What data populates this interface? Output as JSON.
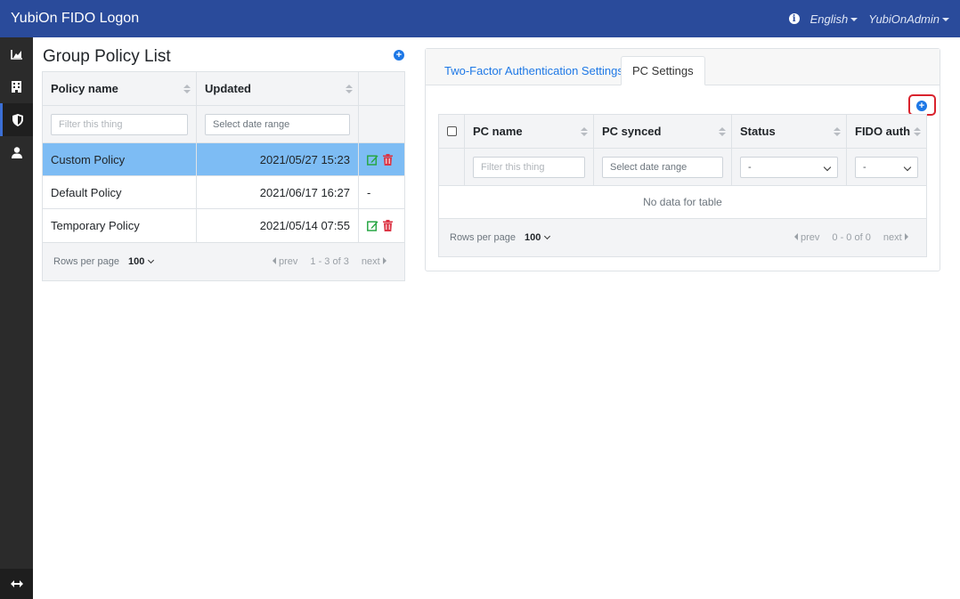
{
  "navbar": {
    "brand": "YubiOn FIDO Logon",
    "language": "English",
    "user": "YubiOnAdmin"
  },
  "sidebar": {
    "items": [
      {
        "icon": "chart-icon"
      },
      {
        "icon": "building-icon"
      },
      {
        "icon": "shield-icon",
        "active": true
      },
      {
        "icon": "user-icon"
      }
    ],
    "bottom_icon": "expand-arrows-icon"
  },
  "policy_list": {
    "title": "Group Policy List",
    "columns": [
      "Policy name",
      "Updated"
    ],
    "filters": {
      "name_placeholder": "Filter this thing",
      "date_placeholder": "Select date range"
    },
    "rows": [
      {
        "name": "Custom Policy",
        "updated": "2021/05/27 15:23",
        "actions": "edit-delete",
        "selected": true
      },
      {
        "name": "Default Policy",
        "updated": "2021/06/17 16:27",
        "actions": "-"
      },
      {
        "name": "Temporary Policy",
        "updated": "2021/05/14 07:55",
        "actions": "edit-delete"
      }
    ],
    "footer": {
      "rows_per_page_label": "Rows per page",
      "rows_per_page_value": "100",
      "prev": "prev",
      "range": "1 - 3 of 3",
      "next": "next"
    }
  },
  "settings": {
    "tabs": [
      {
        "label": "Two-Factor Authentication Settings",
        "active": false
      },
      {
        "label": "PC Settings",
        "active": true
      }
    ],
    "pc_table": {
      "columns": [
        "PC name",
        "PC synced",
        "Status",
        "FIDO auth"
      ],
      "filters": {
        "name_placeholder": "Filter this thing",
        "date_placeholder": "Select date range",
        "status_value": "-",
        "fido_value": "-"
      },
      "empty_text": "No data for table",
      "footer": {
        "rows_per_page_label": "Rows per page",
        "rows_per_page_value": "100",
        "prev": "prev",
        "range": "0 - 0 of 0",
        "next": "next"
      }
    }
  },
  "colors": {
    "navbar": "#2a4b9b",
    "sidebar": "#2b2b2b",
    "selected_row": "#7dbcf4",
    "accent": "#1e78e6",
    "edit": "#28a745",
    "delete": "#dc3545",
    "highlight": "#d9232d"
  }
}
